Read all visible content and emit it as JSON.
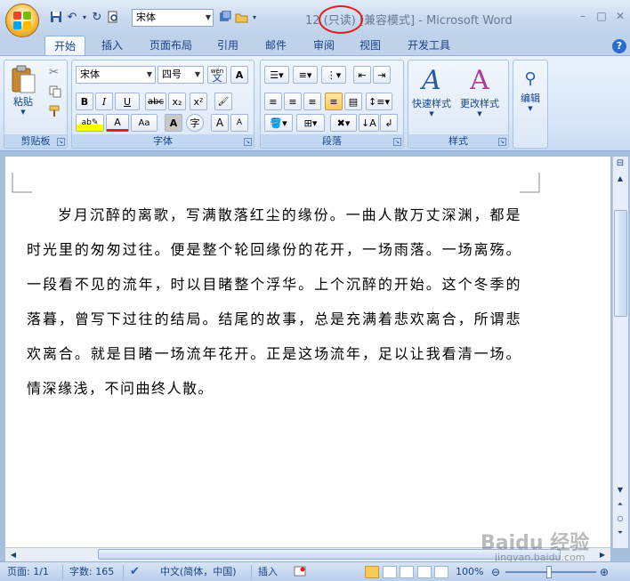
{
  "window": {
    "title_prefix": "12",
    "title_readonly": "(只读)",
    "title_suffix": "[兼容模式] - Microsoft Word",
    "minimize": "–",
    "maximize": "□",
    "close": "✕"
  },
  "qat": {
    "font_value": "宋体"
  },
  "tabs": [
    {
      "label": "开始",
      "active": true
    },
    {
      "label": "插入"
    },
    {
      "label": "页面布局"
    },
    {
      "label": "引用"
    },
    {
      "label": "邮件"
    },
    {
      "label": "审阅"
    },
    {
      "label": "视图"
    },
    {
      "label": "开发工具"
    }
  ],
  "ribbon": {
    "clipboard": {
      "label": "剪贴板",
      "paste": "粘贴"
    },
    "font": {
      "label": "字体",
      "font_name": "宋体",
      "font_size": "四号",
      "bold": "B",
      "italic": "I",
      "underline": "U",
      "strike": "abc",
      "subscript": "x₂",
      "superscript": "x²",
      "wen": "wén",
      "wen_char": "文",
      "grow": "A",
      "shrink": "A",
      "char_border": "A",
      "char_shading": "A",
      "enclose": "字",
      "font_color": "A",
      "change_case": "Aa"
    },
    "paragraph": {
      "label": "段落"
    },
    "styles": {
      "label": "样式",
      "quick": "快速样式",
      "change": "更改样式"
    },
    "editing": {
      "label": "编辑"
    }
  },
  "document": {
    "paragraph": "岁月沉醉的离歌，写满散落红尘的缘份。一曲人散万丈深渊，都是时光里的匆匆过往。便是整个轮回缘份的花开，一场雨落。一场离殇。一段看不见的流年，时以目睹整个浮华。上个沉醉的开始。这个冬季的落暮，曾写下过往的结局。结尾的故事，总是充满着悲欢离合，所谓悲欢离合。就是目睹一场流年花开。正是这场流年，足以让我看清一场。情深缘浅，不问曲终人散。"
  },
  "status": {
    "page": "页面: 1/1",
    "words": "字数: 165",
    "language": "中文(简体，中国)",
    "insert": "插入",
    "zoom": "100%"
  },
  "watermark": {
    "text": "Baidu 经验",
    "url": "jingyan.baidu.com"
  },
  "colors": {
    "accent": "#15428b",
    "readonly_circle": "#e02020"
  }
}
